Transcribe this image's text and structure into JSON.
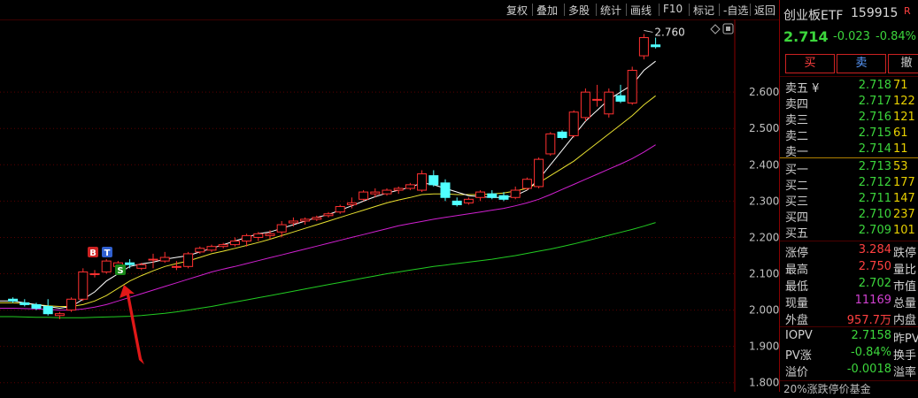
{
  "toolbar": {
    "items": [
      "复权",
      "叠加",
      "多股",
      "统计",
      "画线",
      "F10",
      "标记",
      "-自选",
      "返回"
    ]
  },
  "chart": {
    "price_labels": [
      "2.600",
      "2.500",
      "2.400",
      "2.300",
      "2.200",
      "2.100",
      "2.000",
      "1.900",
      "1.800"
    ],
    "max_label": "2.760",
    "marker_b": "B",
    "marker_t": "T",
    "marker_s": "S"
  },
  "chart_data": {
    "type": "candlestick",
    "y_range": [
      1.775,
      2.8
    ],
    "candles": [
      [
        2.03,
        2.035,
        2.02,
        2.025
      ],
      [
        2.02,
        2.03,
        2.01,
        2.015
      ],
      [
        2.015,
        2.02,
        2.0,
        2.005
      ],
      [
        2.01,
        2.03,
        1.985,
        1.99
      ],
      [
        1.985,
        1.995,
        1.975,
        1.99
      ],
      [
        2.0,
        2.035,
        1.995,
        2.03
      ],
      [
        2.03,
        2.115,
        2.025,
        2.105
      ],
      [
        2.1,
        2.11,
        2.09,
        2.1
      ],
      [
        2.105,
        2.14,
        2.1,
        2.135
      ],
      [
        2.12,
        2.135,
        2.11,
        2.13
      ],
      [
        2.13,
        2.14,
        2.115,
        2.125
      ],
      [
        2.115,
        2.13,
        2.11,
        2.125
      ],
      [
        2.14,
        2.155,
        2.115,
        2.14
      ],
      [
        2.135,
        2.16,
        2.13,
        2.145
      ],
      [
        2.12,
        2.135,
        2.11,
        2.12
      ],
      [
        2.12,
        2.16,
        2.115,
        2.155
      ],
      [
        2.16,
        2.175,
        2.155,
        2.17
      ],
      [
        2.165,
        2.18,
        2.16,
        2.175
      ],
      [
        2.175,
        2.185,
        2.17,
        2.18
      ],
      [
        2.18,
        2.2,
        2.175,
        2.19
      ],
      [
        2.19,
        2.21,
        2.175,
        2.205
      ],
      [
        2.2,
        2.215,
        2.19,
        2.21
      ],
      [
        2.205,
        2.22,
        2.195,
        2.21
      ],
      [
        2.215,
        2.245,
        2.2,
        2.235
      ],
      [
        2.24,
        2.255,
        2.23,
        2.245
      ],
      [
        2.245,
        2.255,
        2.235,
        2.25
      ],
      [
        2.25,
        2.26,
        2.245,
        2.255
      ],
      [
        2.26,
        2.27,
        2.255,
        2.265
      ],
      [
        2.27,
        2.29,
        2.265,
        2.285
      ],
      [
        2.29,
        2.31,
        2.28,
        2.295
      ],
      [
        2.305,
        2.33,
        2.3,
        2.325
      ],
      [
        2.32,
        2.335,
        2.31,
        2.325
      ],
      [
        2.32,
        2.335,
        2.315,
        2.33
      ],
      [
        2.33,
        2.34,
        2.32,
        2.335
      ],
      [
        2.335,
        2.35,
        2.33,
        2.345
      ],
      [
        2.33,
        2.385,
        2.325,
        2.375
      ],
      [
        2.37,
        2.385,
        2.34,
        2.345
      ],
      [
        2.35,
        2.36,
        2.3,
        2.31
      ],
      [
        2.3,
        2.31,
        2.285,
        2.29
      ],
      [
        2.295,
        2.31,
        2.29,
        2.305
      ],
      [
        2.31,
        2.33,
        2.3,
        2.325
      ],
      [
        2.32,
        2.33,
        2.305,
        2.31
      ],
      [
        2.315,
        2.325,
        2.3,
        2.305
      ],
      [
        2.31,
        2.34,
        2.305,
        2.33
      ],
      [
        2.335,
        2.365,
        2.33,
        2.36
      ],
      [
        2.34,
        2.42,
        2.335,
        2.415
      ],
      [
        2.43,
        2.49,
        2.425,
        2.485
      ],
      [
        2.49,
        2.495,
        2.47,
        2.475
      ],
      [
        2.48,
        2.55,
        2.475,
        2.545
      ],
      [
        2.53,
        2.61,
        2.52,
        2.6
      ],
      [
        2.58,
        2.62,
        2.56,
        2.58
      ],
      [
        2.54,
        2.61,
        2.53,
        2.6
      ],
      [
        2.59,
        2.62,
        2.57,
        2.575
      ],
      [
        2.57,
        2.67,
        2.565,
        2.66
      ],
      [
        2.7,
        2.76,
        2.69,
        2.75
      ],
      [
        2.73,
        2.75,
        2.72,
        2.725
      ]
    ],
    "ma5": [
      2.025,
      2.02,
      2.015,
      2.01,
      2.005,
      2.01,
      2.03,
      2.05,
      2.08,
      2.1,
      2.12,
      2.127,
      2.132,
      2.14,
      2.145,
      2.15,
      2.16,
      2.17,
      2.18,
      2.19,
      2.2,
      2.21,
      2.215,
      2.225,
      2.235,
      2.245,
      2.255,
      2.263,
      2.275,
      2.287,
      2.3,
      2.312,
      2.322,
      2.33,
      2.338,
      2.35,
      2.345,
      2.335,
      2.325,
      2.315,
      2.312,
      2.31,
      2.31,
      2.315,
      2.33,
      2.36,
      2.4,
      2.44,
      2.48,
      2.52,
      2.55,
      2.58,
      2.6,
      2.62,
      2.66,
      2.685
    ],
    "ma10": [
      2.02,
      2.018,
      2.015,
      2.012,
      2.01,
      2.01,
      2.015,
      2.025,
      2.04,
      2.06,
      2.08,
      2.095,
      2.108,
      2.12,
      2.128,
      2.135,
      2.145,
      2.155,
      2.162,
      2.17,
      2.178,
      2.186,
      2.195,
      2.205,
      2.215,
      2.225,
      2.235,
      2.245,
      2.255,
      2.265,
      2.275,
      2.285,
      2.295,
      2.303,
      2.31,
      2.318,
      2.32,
      2.32,
      2.318,
      2.318,
      2.318,
      2.32,
      2.322,
      2.328,
      2.335,
      2.35,
      2.37,
      2.39,
      2.41,
      2.435,
      2.46,
      2.485,
      2.51,
      2.535,
      2.565,
      2.59
    ],
    "ma20": [
      2.005,
      2.004,
      2.003,
      2.002,
      2.0,
      2.0,
      2.003,
      2.008,
      2.015,
      2.025,
      2.035,
      2.045,
      2.055,
      2.065,
      2.075,
      2.085,
      2.095,
      2.105,
      2.113,
      2.12,
      2.128,
      2.136,
      2.144,
      2.152,
      2.16,
      2.168,
      2.176,
      2.184,
      2.192,
      2.2,
      2.208,
      2.216,
      2.224,
      2.232,
      2.238,
      2.244,
      2.25,
      2.255,
      2.26,
      2.265,
      2.27,
      2.275,
      2.28,
      2.287,
      2.295,
      2.305,
      2.318,
      2.332,
      2.346,
      2.36,
      2.374,
      2.388,
      2.402,
      2.417,
      2.435,
      2.455
    ],
    "ma60": [
      1.982,
      1.981,
      1.98,
      1.98,
      1.979,
      1.979,
      1.979,
      1.98,
      1.981,
      1.982,
      1.983,
      1.985,
      1.988,
      1.991,
      1.995,
      2.0,
      2.005,
      2.01,
      2.016,
      2.022,
      2.028,
      2.034,
      2.04,
      2.046,
      2.052,
      2.058,
      2.064,
      2.07,
      2.076,
      2.082,
      2.088,
      2.094,
      2.1,
      2.105,
      2.11,
      2.115,
      2.12,
      2.124,
      2.128,
      2.132,
      2.136,
      2.14,
      2.145,
      2.15,
      2.156,
      2.162,
      2.168,
      2.175,
      2.182,
      2.19,
      2.198,
      2.206,
      2.214,
      2.222,
      2.231,
      2.241
    ]
  },
  "quote": {
    "name": "创业板ETF",
    "code": "159915",
    "badge": "R",
    "price": "2.714",
    "change": "-0.023",
    "change_pct": "-0.84%",
    "buy_btn": "买",
    "sell_btn": "卖",
    "cancel_btn": "撤"
  },
  "orderbook": {
    "asks": [
      {
        "label": "卖五 ¥",
        "price": "2.718",
        "vol": "71"
      },
      {
        "label": "卖四",
        "price": "2.717",
        "vol": "122"
      },
      {
        "label": "卖三",
        "price": "2.716",
        "vol": "121"
      },
      {
        "label": "卖二",
        "price": "2.715",
        "vol": "61"
      },
      {
        "label": "卖一",
        "price": "2.714",
        "vol": "11"
      }
    ],
    "bids": [
      {
        "label": "买一",
        "price": "2.713",
        "vol": "53"
      },
      {
        "label": "买二",
        "price": "2.712",
        "vol": "177"
      },
      {
        "label": "买三",
        "price": "2.711",
        "vol": "147"
      },
      {
        "label": "买四",
        "price": "2.710",
        "vol": "237"
      },
      {
        "label": "买五",
        "price": "2.709",
        "vol": "101"
      }
    ]
  },
  "stats": [
    {
      "label": "涨停",
      "value": "3.284",
      "color": "#ff4040",
      "label2": "跌停"
    },
    {
      "label": "最高",
      "value": "2.750",
      "color": "#ff4040",
      "label2": "量比"
    },
    {
      "label": "最低",
      "value": "2.702",
      "color": "#3cd63c",
      "label2": "市值"
    },
    {
      "label": "现量",
      "value": "11169",
      "color": "#d040d0",
      "label2": "总量"
    },
    {
      "label": "外盘",
      "value": "957.7万",
      "color": "#ff4040",
      "label2": "内盘"
    }
  ],
  "iopv": [
    {
      "label": "IOPV",
      "value": "2.7158",
      "color": "#3cd63c",
      "label2": "昨PV"
    },
    {
      "label": "PV涨",
      "value": "-0.84%",
      "color": "#3cd63c",
      "label2": "换手"
    },
    {
      "label": "溢价",
      "value": "-0.0018",
      "color": "#3cd63c",
      "label2": "溢率"
    }
  ],
  "footer": "20%涨跌停价基金"
}
